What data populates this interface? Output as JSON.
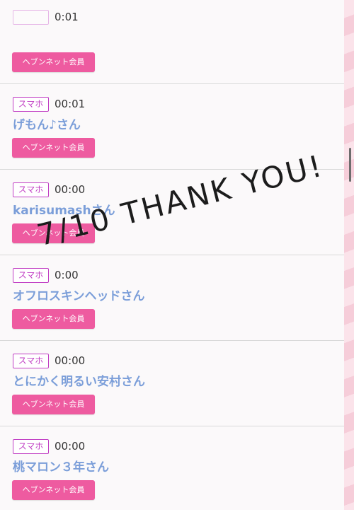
{
  "entries": [
    {
      "badge": "",
      "time": "0:01",
      "name": "",
      "button": "ヘブンネット会員"
    },
    {
      "badge": "スマホ",
      "time": "00:01",
      "name": "げもん♪さん",
      "button": "ヘブンネット会員"
    },
    {
      "badge": "スマホ",
      "time": "00:00",
      "name": "karisumashさん",
      "button": "ヘブンネット会員"
    },
    {
      "badge": "スマホ",
      "time": "0:00",
      "name": "オフロスキンヘッドさん",
      "button": "ヘブンネット会員"
    },
    {
      "badge": "スマホ",
      "time": "00:00",
      "name": "とにかく明るい安村さん",
      "button": "ヘブンネット会員"
    },
    {
      "badge": "スマホ",
      "time": "00:00",
      "name": "桃マロン３年さん",
      "button": "ヘブンネット会員"
    }
  ],
  "overlay": {
    "text": "7/10 THANK YOU!"
  },
  "colors": {
    "badge": "#c13fc4",
    "name": "#7b9ed9",
    "button": "#ee5ba0",
    "overlay": "#1c1c1c"
  }
}
